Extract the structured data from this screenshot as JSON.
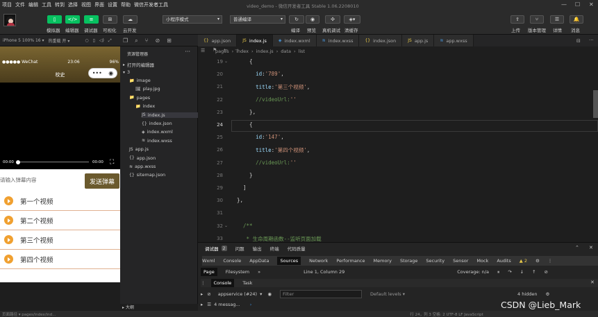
{
  "menu": [
    "项目",
    "文件",
    "编辑",
    "工具",
    "转到",
    "选择",
    "视图",
    "界面",
    "设置",
    "帮助",
    "微信开发者工具"
  ],
  "window_title": "video_demo - 微信开发者工具 Stable 1.06.2208010",
  "toolbar": {
    "simulator": "模拟器",
    "editor": "编辑器",
    "debugger": "调试器",
    "visual": "可视化",
    "cloud": "云开发",
    "mode": "小程序模式",
    "compile_mode": "普通编译",
    "compile": "编译",
    "preview": "预览",
    "real_debug": "真机调试",
    "clear_cache": "清缓存",
    "upload": "上传",
    "version": "版本管理",
    "details": "详情",
    "messages": "消息"
  },
  "simulator_header": {
    "device": "iPhone 5 100% 16 ▾",
    "hot_reload": "热重载 开 ▾"
  },
  "phone": {
    "carrier": "●●●●● WeChat",
    "time": "23:06",
    "battery": "96%",
    "title": "校史",
    "video_current": "00:00",
    "video_duration": "00:00",
    "danmu_placeholder": "请输入弹幕内容",
    "danmu_button": "发送弹幕",
    "videos": [
      "第一个视频",
      "第二个视频",
      "第三个视频",
      "第四个视频"
    ]
  },
  "explorer": {
    "header": "资源管理器",
    "open_editors": "打开的编辑器",
    "root": "3",
    "items": [
      {
        "label": "image",
        "indent": 1,
        "icon": "📁",
        "sel": false
      },
      {
        "label": "play.jpg",
        "indent": 2,
        "icon": "🖼",
        "sel": false
      },
      {
        "label": "pages",
        "indent": 1,
        "icon": "📁",
        "sel": false
      },
      {
        "label": "index",
        "indent": 2,
        "icon": "📁",
        "sel": false
      },
      {
        "label": "index.js",
        "indent": 3,
        "icon": "JS",
        "sel": true
      },
      {
        "label": "index.json",
        "indent": 3,
        "icon": "{}",
        "sel": false
      },
      {
        "label": "index.wxml",
        "indent": 3,
        "icon": "◈",
        "sel": false
      },
      {
        "label": "index.wxss",
        "indent": 3,
        "icon": "≋",
        "sel": false
      },
      {
        "label": "app.js",
        "indent": 1,
        "icon": "JS",
        "sel": false
      },
      {
        "label": "app.json",
        "indent": 1,
        "icon": "{}",
        "sel": false
      },
      {
        "label": "app.wxss",
        "indent": 1,
        "icon": "≋",
        "sel": false
      },
      {
        "label": "sitemap.json",
        "indent": 1,
        "icon": "{}",
        "sel": false
      }
    ],
    "outline": "大纲"
  },
  "tabs": [
    {
      "label": "app.json",
      "icon": "{}",
      "active": false
    },
    {
      "label": "index.js",
      "icon": "JS",
      "active": true
    },
    {
      "label": "index.wxml",
      "icon": "◈",
      "active": false
    },
    {
      "label": "index.wxss",
      "icon": "≋",
      "active": false
    },
    {
      "label": "index.json",
      "icon": "{}",
      "active": false
    },
    {
      "label": "app.js",
      "icon": "JS",
      "active": false
    },
    {
      "label": "app.wxss",
      "icon": "≋",
      "active": false
    }
  ],
  "breadcrumb": [
    "pages",
    "›",
    "index",
    "›",
    "index.js",
    "›",
    "data",
    "›",
    "list"
  ],
  "code": [
    {
      "ln": "19",
      "text": "    {"
    },
    {
      "ln": "20",
      "text": "      id:'789',"
    },
    {
      "ln": "21",
      "text": "      title:'第三个视频',"
    },
    {
      "ln": "22",
      "text": "      //videoUrl:''"
    },
    {
      "ln": "23",
      "text": "    },"
    },
    {
      "ln": "24",
      "text": "    {"
    },
    {
      "ln": "25",
      "text": "      id:'147',"
    },
    {
      "ln": "26",
      "text": "      title:'第四个视频',"
    },
    {
      "ln": "27",
      "text": "      //videoUrl:''"
    },
    {
      "ln": "28",
      "text": "    }"
    },
    {
      "ln": "29",
      "text": "  ]"
    },
    {
      "ln": "30",
      "text": "},"
    },
    {
      "ln": "31",
      "text": ""
    },
    {
      "ln": "32",
      "text": "  /**"
    },
    {
      "ln": "33",
      "text": "   * 生命周期函数--监听页面加载"
    }
  ],
  "devtools": {
    "top_tabs": [
      "调试器",
      "2",
      "问题",
      "输出",
      "终端",
      "代码质量"
    ],
    "panels": [
      "Wxml",
      "Console",
      "AppData",
      "Sources",
      "Network",
      "Performance",
      "Memory",
      "Storage",
      "Security",
      "Sensor",
      "Mock",
      "Audits"
    ],
    "active_panel": "Sources",
    "warnings": "▲ 2",
    "sub_tabs": [
      "Page",
      "Filesystem",
      "»"
    ],
    "cursor_pos": "Line 1, Column 29",
    "coverage": "Coverage: n/a",
    "console_tabs": [
      "Console",
      "Task"
    ],
    "context": "appservice (#24)",
    "filter_placeholder": "Filter",
    "levels": "Default levels ▾",
    "hidden": "4 hidden",
    "messages": "4 messag..."
  },
  "watermark": "CSDN @Lieb_Mark",
  "status": {
    "left": "页面路径 ▾  pages/index/ind...",
    "right": "行 24，列 3    空格: 2    UTF-8    LF    JavaScript"
  }
}
